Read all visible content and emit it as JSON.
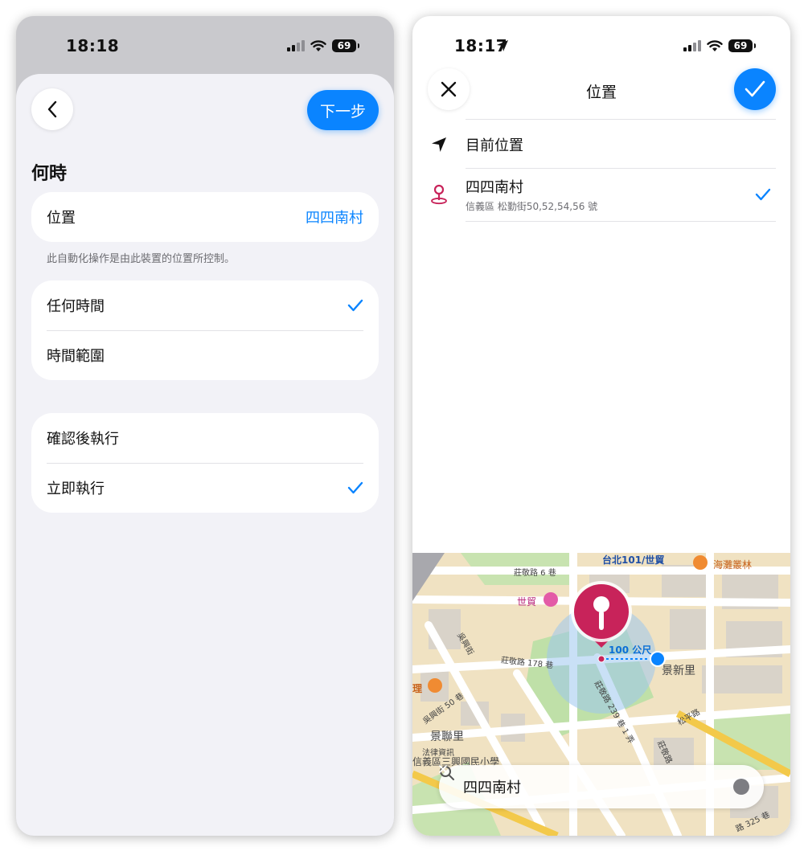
{
  "left_screen": {
    "status": {
      "time": "18:18",
      "battery": "69"
    },
    "next_label": "下一步",
    "heading": "何時",
    "location_row": {
      "label": "位置",
      "value": "四四南村"
    },
    "footnote": "此自動化操作是由此裝置的位置所控制。",
    "time_options": [
      {
        "label": "任何時間",
        "checked": true
      },
      {
        "label": "時間範圍",
        "checked": false
      }
    ],
    "run_options": [
      {
        "label": "確認後執行",
        "checked": false
      },
      {
        "label": "立即執行",
        "checked": true
      }
    ]
  },
  "right_screen": {
    "status": {
      "time": "18:17",
      "battery": "69"
    },
    "title": "位置",
    "current_location_label": "目前位置",
    "selected_place": {
      "name": "四四南村",
      "address": "信義區 松勤街50,52,54,56 號",
      "checked": true
    },
    "map": {
      "labels": {
        "taipei101": "台北101/世貿",
        "forest": "海灘叢林",
        "road_zhuangjing6": "莊敬路 6 巷",
        "shimao": "世貿",
        "road_wuxing": "吳興街",
        "road_zhuangjing178": "莊敬路 178 巷",
        "radius": "100 公尺",
        "jingxin": "景新里",
        "li": "理",
        "road_wuxing50": "吳興街 50 巷",
        "road_zhuangjing239": "莊敬路 239 巷 1 弄",
        "songping": "松平路",
        "jinglian": "景聯里",
        "law": "法律資訊",
        "school": "信義區三興國民小學",
        "zhuangjing_short": "莊敬路",
        "road_325": "路 325 巷"
      },
      "radius_meters": 100
    },
    "search": {
      "value": "四四南村"
    }
  },
  "colors": {
    "accent": "#0a84ff",
    "pin": "#c8235a",
    "sheet_bg": "#f2f2f7"
  }
}
